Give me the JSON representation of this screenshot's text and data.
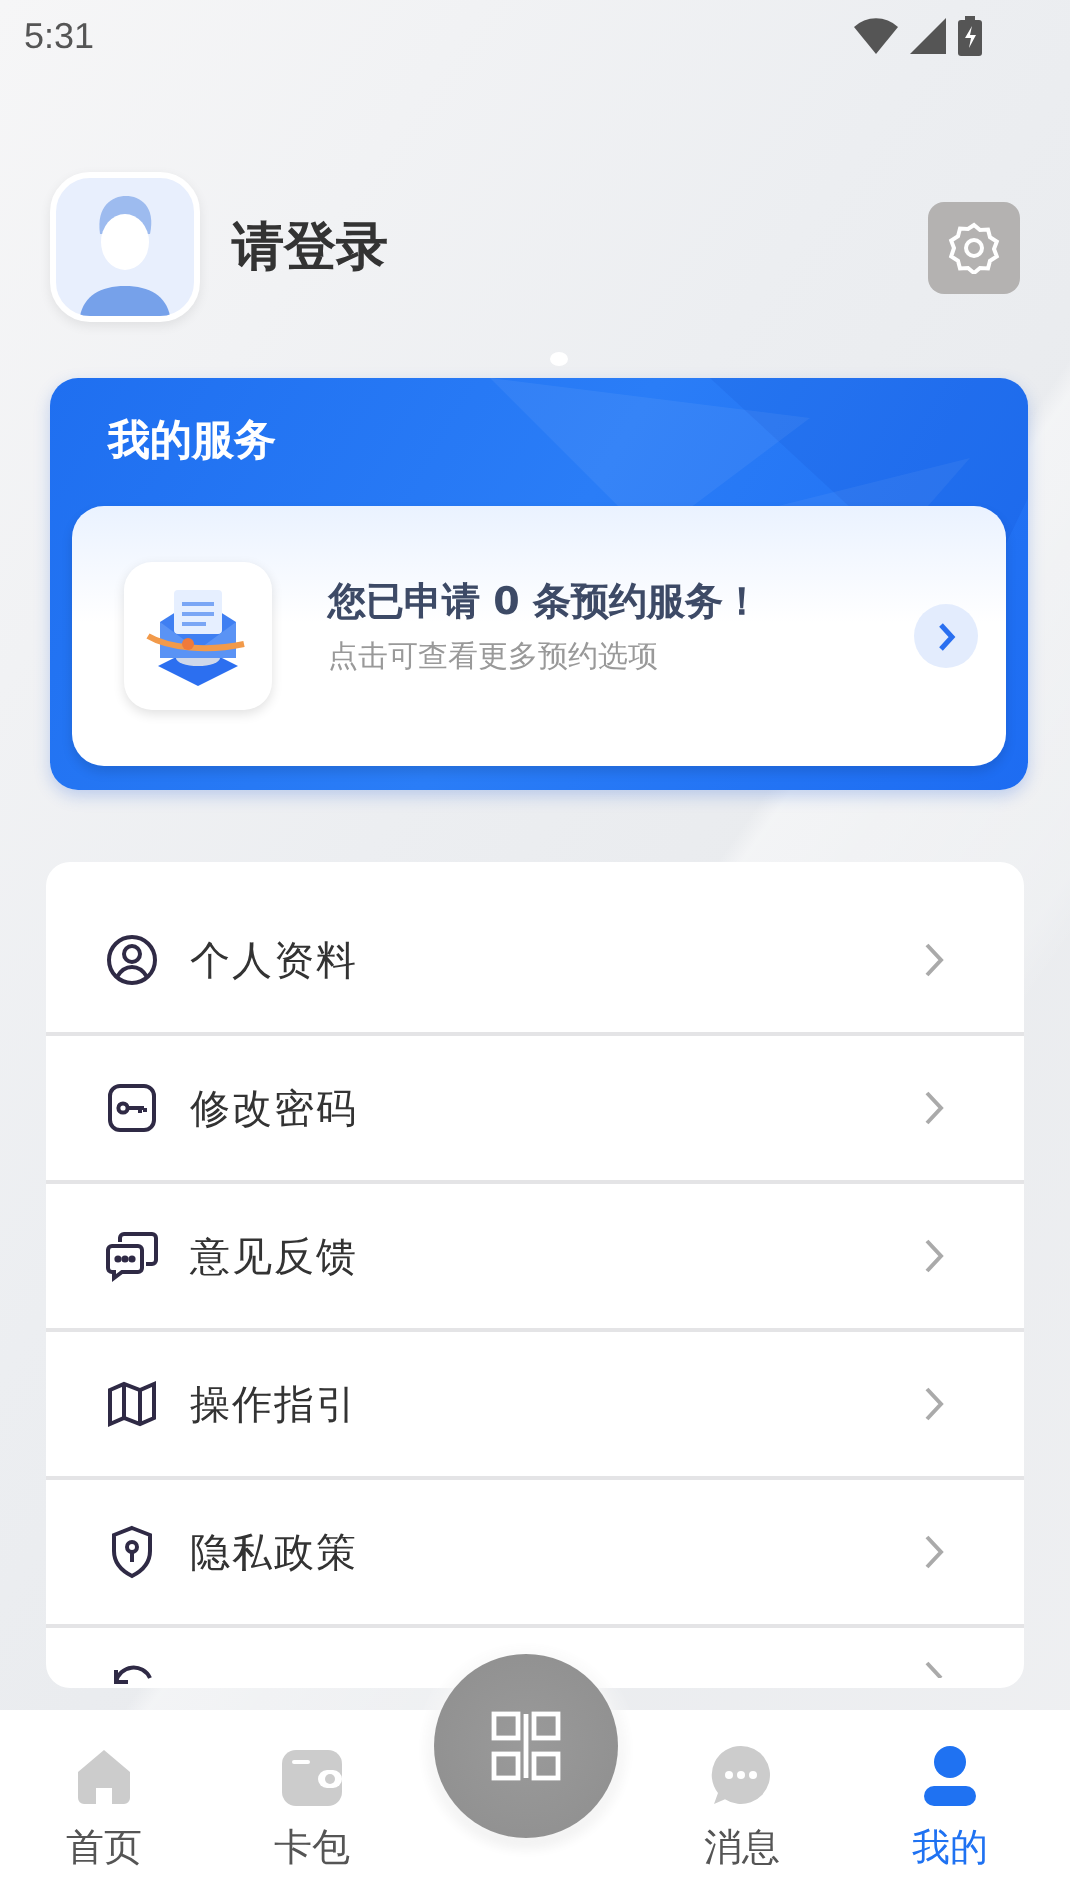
{
  "status_bar": {
    "time": "5:31"
  },
  "profile": {
    "name": "请登录"
  },
  "services": {
    "title": "我的服务",
    "card": {
      "headline": "您已申请 0 条预约服务！",
      "subtitle": "点击可查看更多预约选项"
    }
  },
  "menu": [
    {
      "label": "个人资料"
    },
    {
      "label": "修改密码"
    },
    {
      "label": "意见反馈"
    },
    {
      "label": "操作指引"
    },
    {
      "label": "隐私政策"
    }
  ],
  "tab_bar": {
    "tabs": [
      {
        "kind": "tab",
        "label": "首页",
        "selected": false
      },
      {
        "kind": "tab",
        "label": "卡包",
        "selected": false
      },
      {
        "kind": "scan"
      },
      {
        "kind": "tab",
        "label": "消息",
        "selected": false
      },
      {
        "kind": "tab",
        "label": "我的",
        "selected": true
      }
    ]
  }
}
